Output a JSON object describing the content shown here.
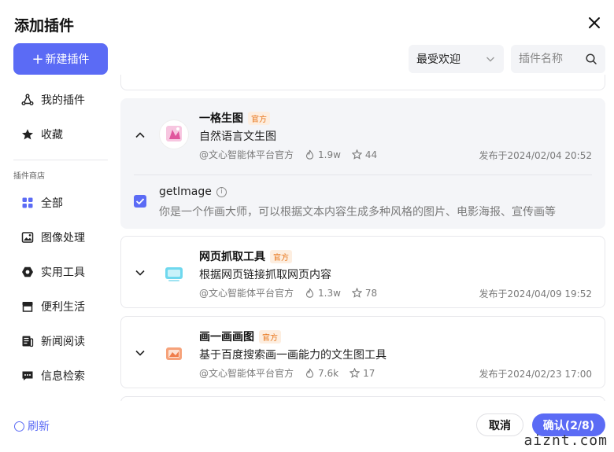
{
  "dialog": {
    "title": "添加插件"
  },
  "sidebar": {
    "new_button": "新建插件",
    "items": [
      {
        "label": "我的插件",
        "icon": "share-nodes-icon"
      },
      {
        "label": "收藏",
        "icon": "star-icon"
      }
    ],
    "store_label": "插件商店",
    "store_items": [
      {
        "label": "全部",
        "icon": "grid-icon"
      },
      {
        "label": "图像处理",
        "icon": "image-icon"
      },
      {
        "label": "实用工具",
        "icon": "tool-icon"
      },
      {
        "label": "便利生活",
        "icon": "store-icon"
      },
      {
        "label": "新闻阅读",
        "icon": "news-icon"
      },
      {
        "label": "信息检索",
        "icon": "chat-search-icon"
      }
    ],
    "refresh": "刷新"
  },
  "toolbar": {
    "sort_value": "最受欢迎",
    "search_placeholder": "插件名称"
  },
  "plugins": [
    {
      "name": "一格生图",
      "badge": "官方",
      "desc": "自然语言文生图",
      "author": "@文心智能体平台官方",
      "hot": "1.9w",
      "stars": "44",
      "date": "发布于2024/02/04  20:52",
      "expanded": true,
      "tool": {
        "name": "getImage",
        "desc": "你是一个作画大师，可以根据文本内容生成多种风格的图片、电影海报、宣传画等",
        "checked": true
      }
    },
    {
      "name": "网页抓取工具",
      "badge": "官方",
      "desc": "根据网页链接抓取网页内容",
      "author": "@文心智能体平台官方",
      "hot": "1.3w",
      "stars": "78",
      "date": "发布于2024/04/09  19:52",
      "expanded": false
    },
    {
      "name": "画一画画图",
      "badge": "官方",
      "desc": "基于百度搜索画一画能力的文生图工具",
      "author": "@文心智能体平台官方",
      "hot": "7.6k",
      "stars": "17",
      "date": "发布于2024/02/23  17:00",
      "expanded": false
    }
  ],
  "footer": {
    "cancel": "取消",
    "confirm": "确认(2/8)"
  },
  "watermark": "aiznt.com",
  "colors": {
    "accent": "#5b6bf5",
    "badge_text": "#e8761b",
    "badge_bg": "#fdeee0"
  }
}
